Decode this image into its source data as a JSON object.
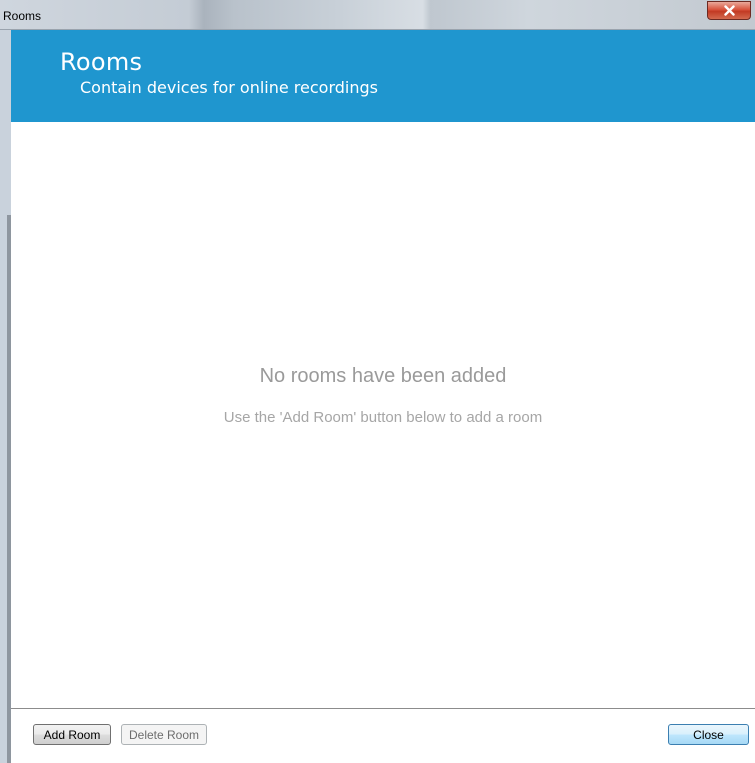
{
  "window": {
    "title": "Rooms",
    "close_glyph": "x-icon"
  },
  "banner": {
    "title": "Rooms",
    "subtitle": "Contain devices for online recordings",
    "color": "#1f96cf"
  },
  "empty_state": {
    "title": "No rooms have been added",
    "hint": "Use the 'Add Room' button below to add a room"
  },
  "footer": {
    "add_label": "Add Room",
    "delete_label": "Delete Room",
    "close_label": "Close"
  }
}
